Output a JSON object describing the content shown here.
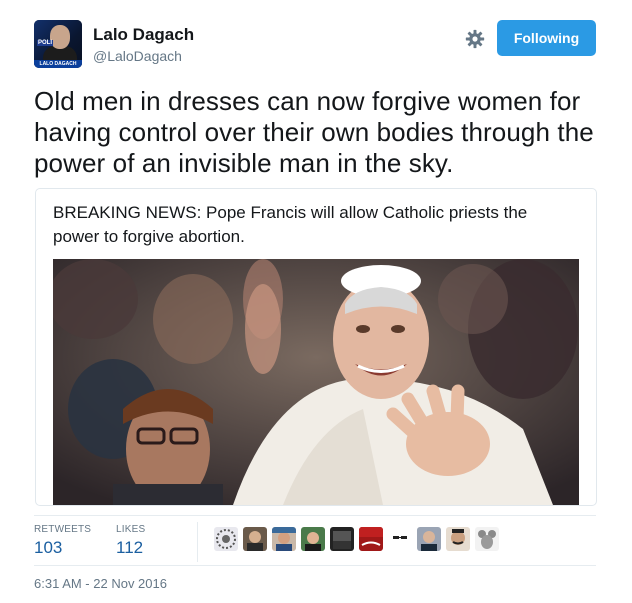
{
  "author": {
    "name": "Lalo Dagach",
    "handle": "@LaloDagach",
    "avatar_tag": "POLI",
    "avatar_caption": "LALO DAGACH"
  },
  "header": {
    "settings_icon": "gear-icon",
    "follow_label": "Following"
  },
  "tweet": {
    "text": "Old men in dresses can now forgive women for having control over their own bodies through the power of an invisible man in the sky."
  },
  "card": {
    "text": "BREAKING NEWS: Pope Francis will allow Catholic priests the power to forgive abortion."
  },
  "stats": {
    "retweets_label": "RETWEETS",
    "retweets_count": "103",
    "likes_label": "LIKES",
    "likes_count": "112",
    "liker_count_shown": 10
  },
  "timestamp": "6:31 AM - 22 Nov 2016",
  "colors": {
    "accent": "#2b9ae4",
    "count_link": "#1b5fa0",
    "muted": "#657786"
  }
}
